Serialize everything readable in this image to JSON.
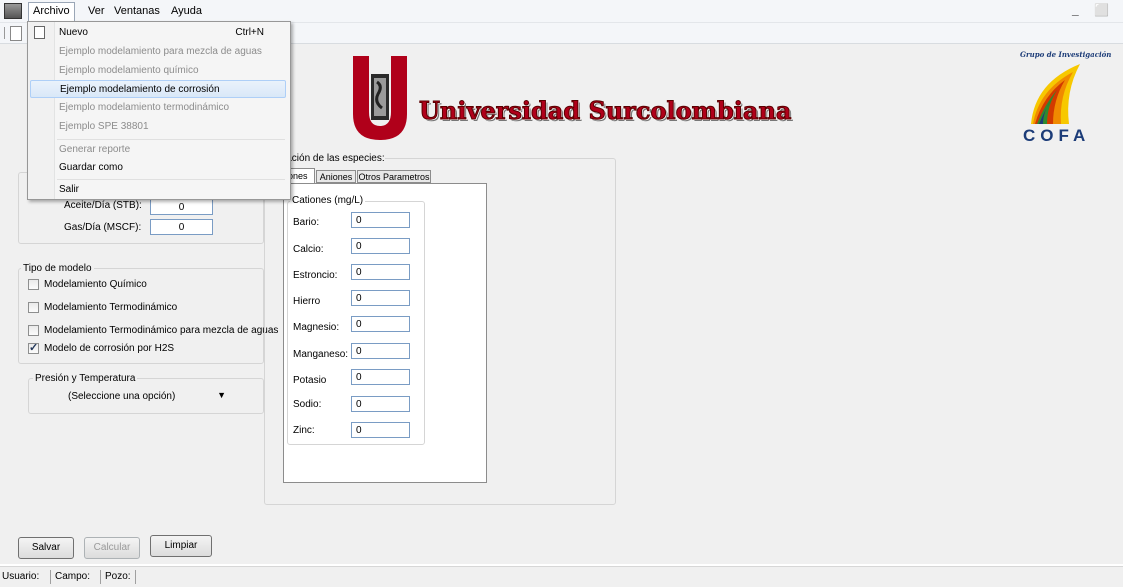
{
  "menubar": {
    "items": [
      "Archivo",
      "Ver",
      "Ventanas",
      "Ayuda"
    ],
    "window_controls": "_ ⬜"
  },
  "file_menu": {
    "items": [
      {
        "label": "Nuevo",
        "shortcut": "Ctrl+N",
        "enabled": true
      },
      {
        "label": "Ejemplo modelamiento para mezcla de aguas",
        "enabled": false
      },
      {
        "label": "Ejemplo modelamiento químico",
        "enabled": false
      },
      {
        "label": "Ejemplo modelamiento de corrosión",
        "enabled": true,
        "highlighted": true
      },
      {
        "label": "Ejemplo modelamiento termodinámico",
        "enabled": false
      },
      {
        "label": "Ejemplo SPE 38801",
        "enabled": false
      },
      {
        "label": "Generar reporte",
        "enabled": false
      },
      {
        "label": "Guardar como",
        "enabled": true
      },
      {
        "label": "Salir",
        "enabled": true
      }
    ]
  },
  "production": {
    "oil_label": "Aceite/Día (STB):",
    "oil_value": "0",
    "gas_label": "Gas/Día (MSCF):",
    "gas_value": "0"
  },
  "model_type": {
    "title": "Tipo de modelo",
    "options": [
      {
        "label": "Modelamiento Químico",
        "checked": false
      },
      {
        "label": "Modelamiento Termodinámico",
        "checked": false
      },
      {
        "label": "Modelamiento Termodinámico para mezcla de aguas",
        "checked": false
      },
      {
        "label": "Modelo de corrosión por H2S",
        "checked": true
      }
    ]
  },
  "pressure_temp": {
    "title": "Presión y Temperatura",
    "selected": "(Seleccione una opción)"
  },
  "concentration": {
    "title": "centración de las especies:",
    "tabs": [
      "iones",
      "Aniones",
      "Otros Parametros"
    ],
    "group_title": "Cationes (mg/L)",
    "cations": [
      {
        "label": "Bario:",
        "value": "0"
      },
      {
        "label": "Calcio:",
        "value": "0"
      },
      {
        "label": "Estroncio:",
        "value": "0"
      },
      {
        "label": "Hierro",
        "value": "0"
      },
      {
        "label": "Magnesio:",
        "value": "0"
      },
      {
        "label": "Manganeso:",
        "value": "0"
      },
      {
        "label": "Potasio",
        "value": "0"
      },
      {
        "label": "Sodio:",
        "value": "0"
      },
      {
        "label": "Zinc:",
        "value": "0"
      }
    ]
  },
  "branding": {
    "university": "Universidad Surcolombiana",
    "cofa_caption": "Grupo de Investigación",
    "cofa_name": "COFA"
  },
  "buttons": {
    "save": "Salvar",
    "calculate": "Calcular",
    "clear": "Limpiar"
  },
  "status": {
    "user": "Usuario:",
    "field": "Campo:",
    "well": "Pozo:"
  },
  "colors": {
    "usco_red": "#b0001a",
    "menu_highlight": "#d9e8f8"
  }
}
